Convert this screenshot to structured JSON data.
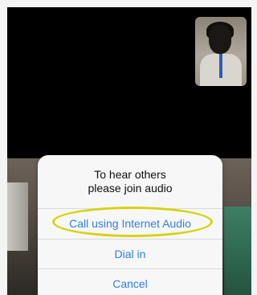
{
  "dialog": {
    "title_line1": "To hear others",
    "title_line2": "please join audio",
    "options": [
      {
        "label": "Call using Internet Audio"
      },
      {
        "label": "Dial in"
      },
      {
        "label": "Cancel"
      }
    ]
  },
  "colors": {
    "accent": "#2f7df6",
    "highlight": "#d8d20e",
    "background": "#000000"
  }
}
